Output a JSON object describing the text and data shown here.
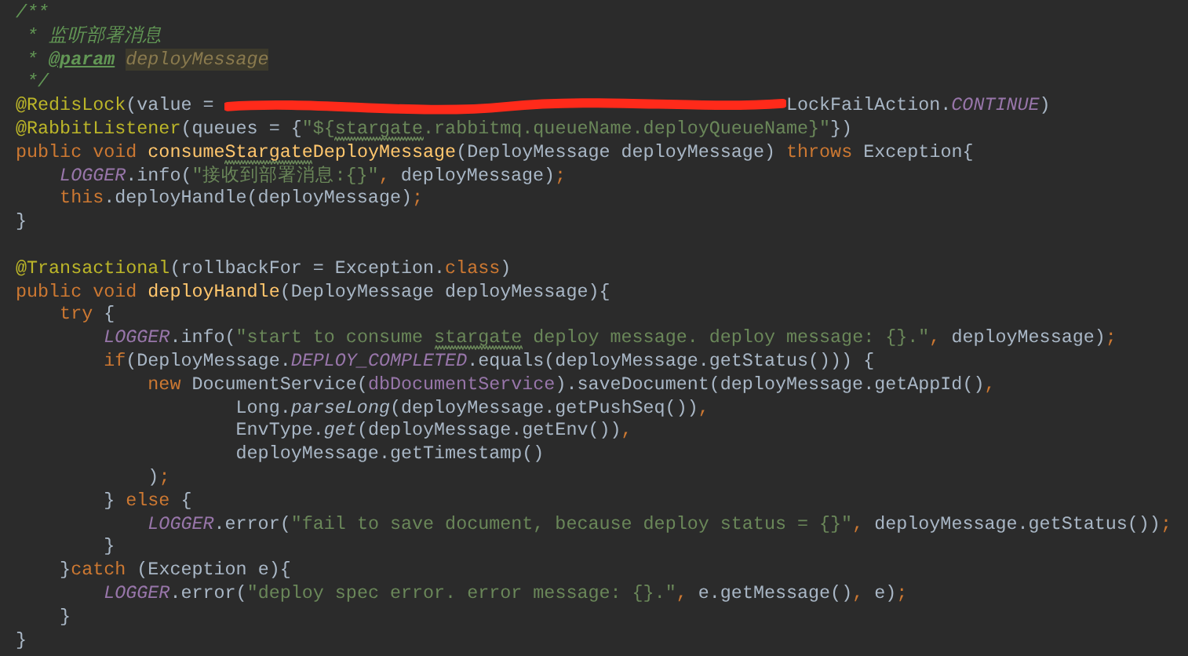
{
  "editor": {
    "blocks": [
      {
        "lines": [
          {
            "tokens": [
              {
                "kind": "comment",
                "text": "/**"
              }
            ]
          },
          {
            "tokens": [
              {
                "kind": "comment",
                "text": " * 监听部署消息"
              }
            ]
          },
          {
            "tokens": [
              {
                "kind": "comment",
                "text": " * "
              },
              {
                "kind": "doctag",
                "text": "@param"
              },
              {
                "kind": "docparam",
                "text": "deployMessage"
              }
            ]
          },
          {
            "tokens": [
              {
                "kind": "comment",
                "text": " */"
              }
            ]
          },
          {
            "tokens": [
              {
                "kind": "annotation",
                "text": "@RedisLock"
              },
              {
                "kind": "plain",
                "text": "(value = "
              },
              {
                "kind": "redaction"
              },
              {
                "kind": "plain",
                "text": "LockFailAction."
              },
              {
                "kind": "field",
                "text": "CONTINUE"
              },
              {
                "kind": "plain",
                "text": ")"
              }
            ]
          },
          {
            "tokens": [
              {
                "kind": "annotation",
                "text": "@RabbitListener"
              },
              {
                "kind": "plain",
                "text": "(queues = {"
              },
              {
                "kind": "string",
                "text": "\"${"
              },
              {
                "kind": "string",
                "text": "stargate",
                "typo": true
              },
              {
                "kind": "string",
                "text": ".rabbitmq.queueName.deployQueueName}\""
              },
              {
                "kind": "plain",
                "text": "})"
              }
            ]
          },
          {
            "tokens": [
              {
                "kind": "keyword",
                "text": "public void "
              },
              {
                "kind": "method",
                "text": "consume"
              },
              {
                "kind": "method",
                "text": "Stargate",
                "typo": true
              },
              {
                "kind": "method",
                "text": "DeployMessage"
              },
              {
                "kind": "plain",
                "text": "(DeployMessage deployMessage) "
              },
              {
                "kind": "keyword",
                "text": "throws"
              },
              {
                "kind": "plain",
                "text": " Exception{"
              }
            ]
          },
          {
            "tokens": [
              {
                "kind": "field",
                "text": "    LOGGER"
              },
              {
                "kind": "plain",
                "text": ".info("
              },
              {
                "kind": "string",
                "text": "\"接收到部署消息:{}\""
              },
              {
                "kind": "keyword",
                "text": ", "
              },
              {
                "kind": "plain",
                "text": "deployMessage)"
              },
              {
                "kind": "keyword",
                "text": ";"
              }
            ]
          },
          {
            "tokens": [
              {
                "kind": "keyword",
                "text": "    this"
              },
              {
                "kind": "plain",
                "text": ".deployHandle(deployMessage)"
              },
              {
                "kind": "keyword",
                "text": ";"
              }
            ]
          },
          {
            "tokens": [
              {
                "kind": "plain",
                "text": "}"
              }
            ]
          }
        ]
      },
      {
        "lines": [
          {
            "tokens": [
              {
                "kind": "annotation",
                "text": "@Transactional"
              },
              {
                "kind": "plain",
                "text": "(rollbackFor = Exception."
              },
              {
                "kind": "keyword",
                "text": "class"
              },
              {
                "kind": "plain",
                "text": ")"
              }
            ]
          },
          {
            "tokens": [
              {
                "kind": "keyword",
                "text": "public void "
              },
              {
                "kind": "method",
                "text": "deployHandle"
              },
              {
                "kind": "plain",
                "text": "(DeployMessage deployMessage){"
              }
            ]
          },
          {
            "tokens": [
              {
                "kind": "keyword",
                "text": "    try"
              },
              {
                "kind": "plain",
                "text": " {"
              }
            ]
          },
          {
            "tokens": [
              {
                "kind": "field",
                "text": "        LOGGER"
              },
              {
                "kind": "plain",
                "text": ".info("
              },
              {
                "kind": "string",
                "text": "\"start to consume "
              },
              {
                "kind": "string",
                "text": "stargate",
                "typo": true
              },
              {
                "kind": "string",
                "text": " deploy message. deploy message: {}.\""
              },
              {
                "kind": "keyword",
                "text": ", "
              },
              {
                "kind": "plain",
                "text": "deployMessage)"
              },
              {
                "kind": "keyword",
                "text": ";"
              }
            ]
          },
          {
            "tokens": [
              {
                "kind": "keyword",
                "text": "        if"
              },
              {
                "kind": "plain",
                "text": "(DeployMessage."
              },
              {
                "kind": "field",
                "text": "DEPLOY_COMPLETED"
              },
              {
                "kind": "plain",
                "text": ".equals(deployMessage.getStatus())) {"
              }
            ]
          },
          {
            "tokens": [
              {
                "kind": "keyword",
                "text": "            new"
              },
              {
                "kind": "plain",
                "text": " DocumentService("
              },
              {
                "kind": "member",
                "text": "dbDocumentService"
              },
              {
                "kind": "plain",
                "text": ").saveDocument(deployMessage.getAppId()"
              },
              {
                "kind": "keyword",
                "text": ","
              }
            ]
          },
          {
            "tokens": [
              {
                "kind": "plain",
                "text": "                    Long."
              },
              {
                "kind": "static",
                "text": "parseLong"
              },
              {
                "kind": "plain",
                "text": "(deployMessage.getPushSeq())"
              },
              {
                "kind": "keyword",
                "text": ","
              }
            ]
          },
          {
            "tokens": [
              {
                "kind": "plain",
                "text": "                    EnvType."
              },
              {
                "kind": "static",
                "text": "get"
              },
              {
                "kind": "plain",
                "text": "(deployMessage.getEnv())"
              },
              {
                "kind": "keyword",
                "text": ","
              }
            ]
          },
          {
            "tokens": [
              {
                "kind": "plain",
                "text": "                    deployMessage.getTimestamp()"
              }
            ]
          },
          {
            "tokens": [
              {
                "kind": "plain",
                "text": "            )"
              },
              {
                "kind": "keyword",
                "text": ";"
              }
            ]
          },
          {
            "tokens": [
              {
                "kind": "plain",
                "text": "        } "
              },
              {
                "kind": "keyword",
                "text": "else"
              },
              {
                "kind": "plain",
                "text": " {"
              }
            ]
          },
          {
            "tokens": [
              {
                "kind": "field",
                "text": "            LOGGER"
              },
              {
                "kind": "plain",
                "text": ".error("
              },
              {
                "kind": "string",
                "text": "\"fail to save document, because deploy status = {}\""
              },
              {
                "kind": "keyword",
                "text": ", "
              },
              {
                "kind": "plain",
                "text": "deployMessage.getStatus())"
              },
              {
                "kind": "keyword",
                "text": ";"
              }
            ]
          },
          {
            "tokens": [
              {
                "kind": "plain",
                "text": "        }"
              }
            ]
          },
          {
            "tokens": [
              {
                "kind": "plain",
                "text": "    }"
              },
              {
                "kind": "keyword",
                "text": "catch"
              },
              {
                "kind": "plain",
                "text": " (Exception e){"
              }
            ]
          },
          {
            "tokens": [
              {
                "kind": "field",
                "text": "        LOGGER"
              },
              {
                "kind": "plain",
                "text": ".error("
              },
              {
                "kind": "string",
                "text": "\"deploy spec error. error message: {}.\""
              },
              {
                "kind": "keyword",
                "text": ", "
              },
              {
                "kind": "plain",
                "text": "e.getMessage()"
              },
              {
                "kind": "keyword",
                "text": ", "
              },
              {
                "kind": "plain",
                "text": "e)"
              },
              {
                "kind": "keyword",
                "text": ";"
              }
            ]
          },
          {
            "tokens": [
              {
                "kind": "plain",
                "text": "    }"
              }
            ]
          },
          {
            "tokens": [
              {
                "kind": "plain",
                "text": "}"
              }
            ]
          }
        ]
      }
    ]
  }
}
